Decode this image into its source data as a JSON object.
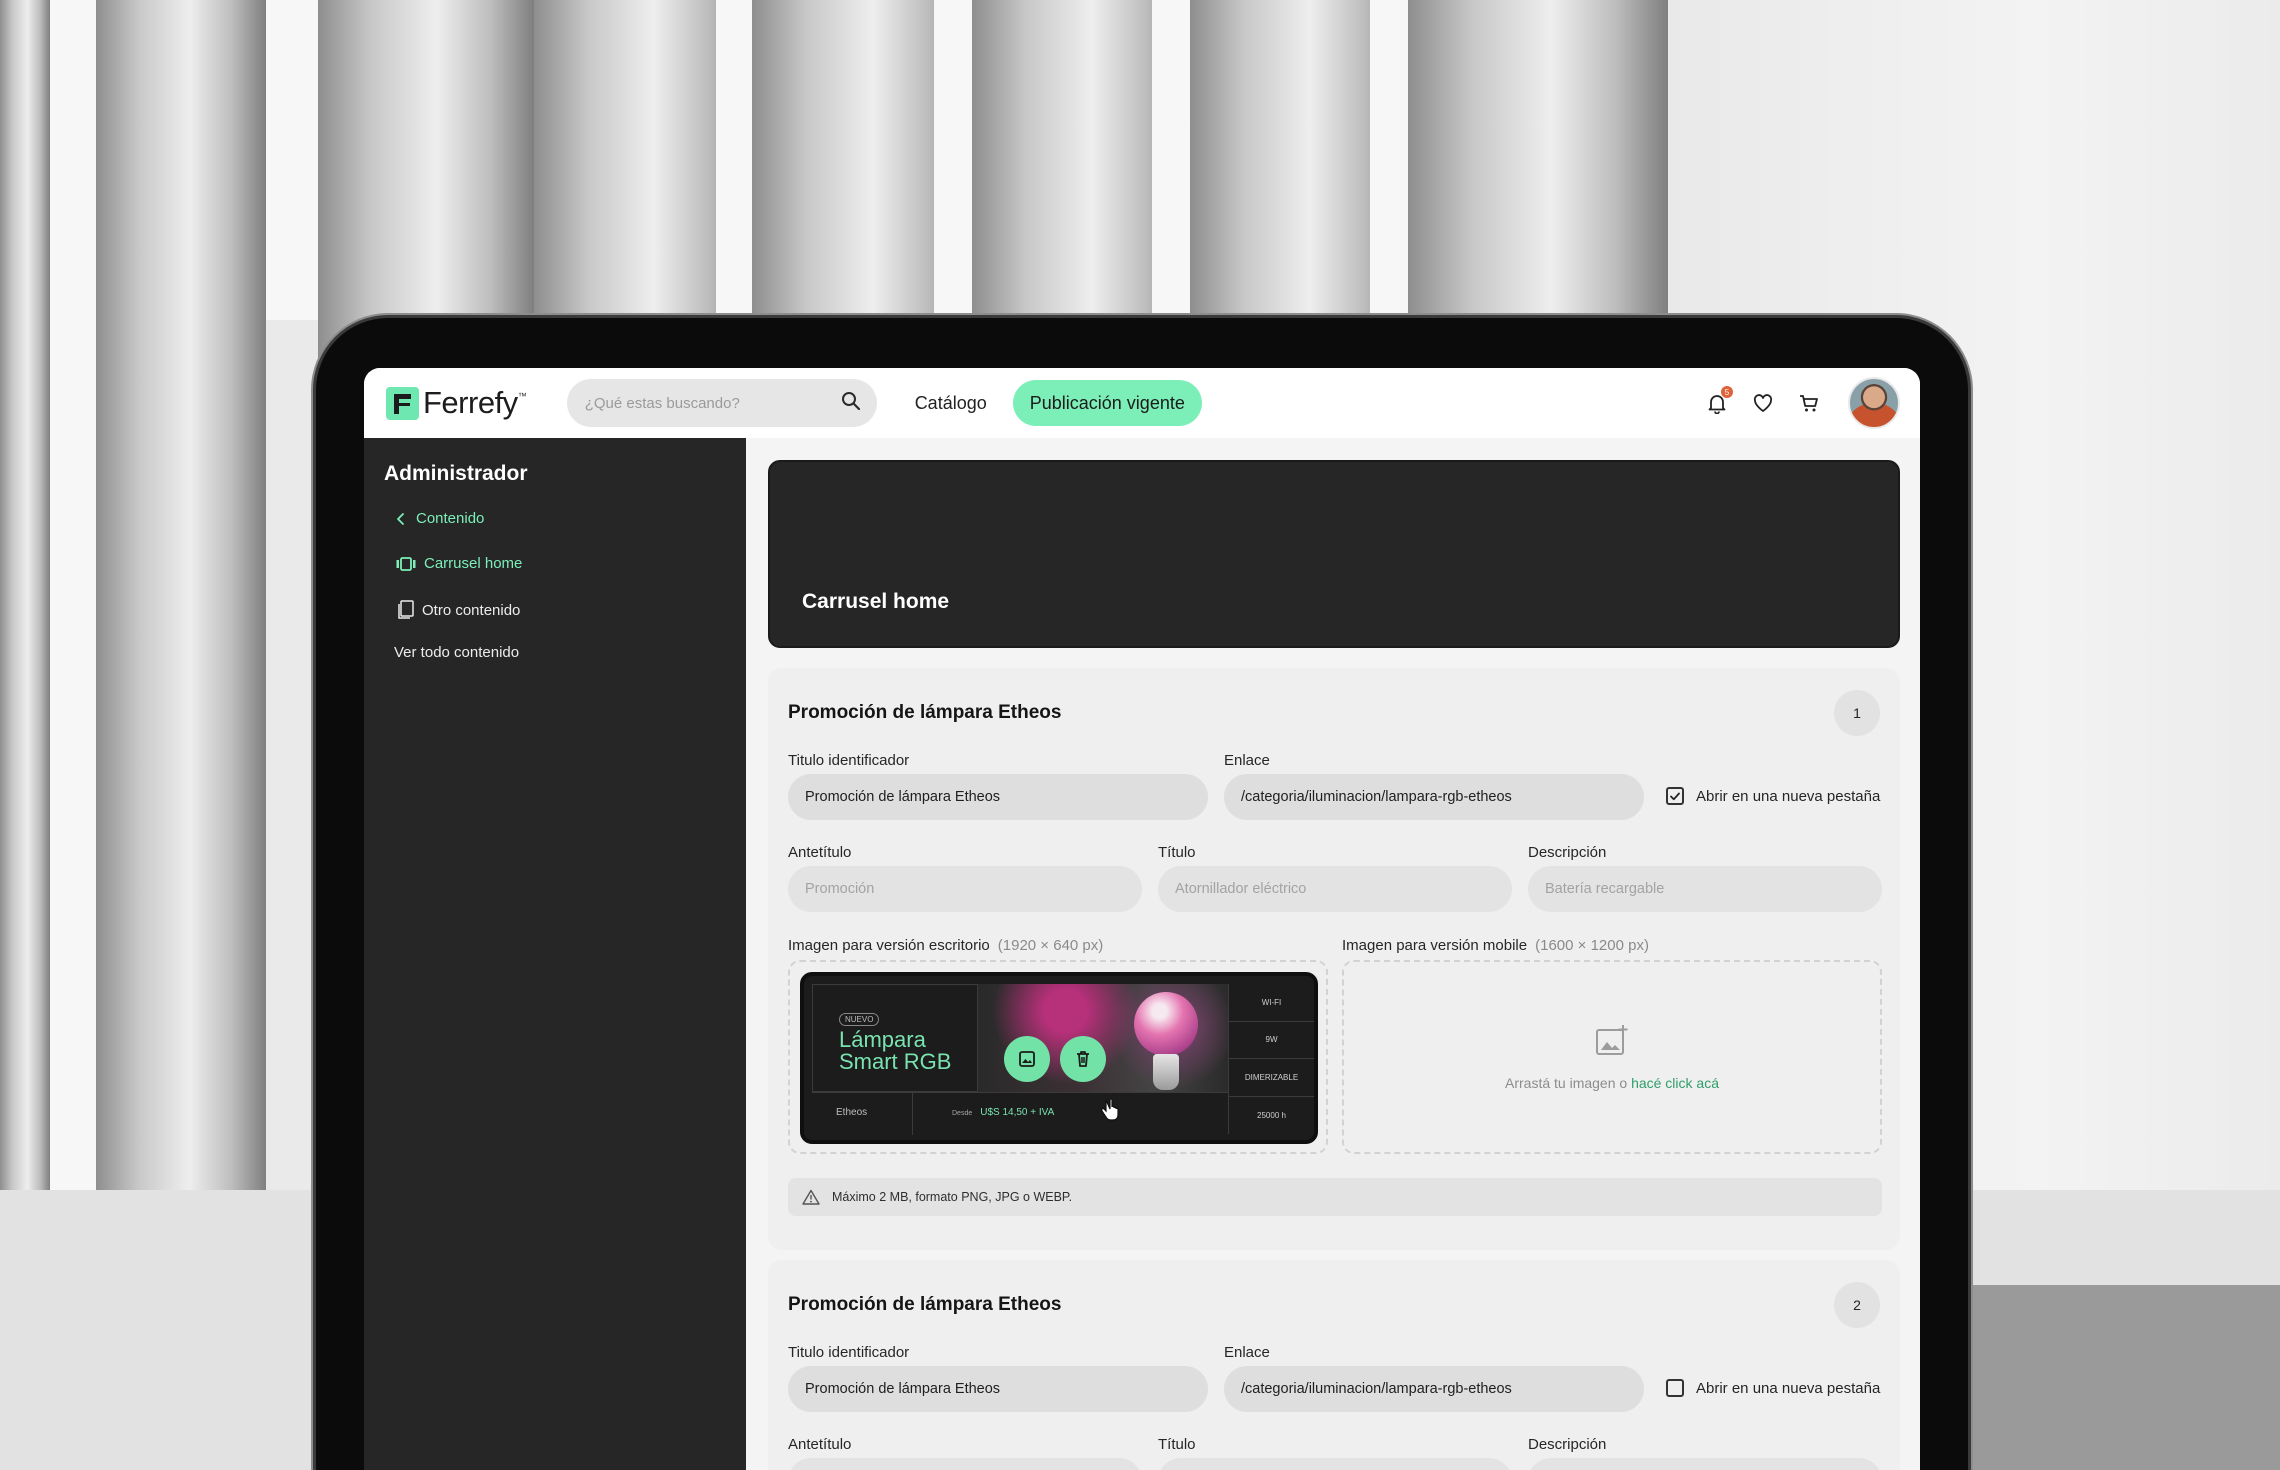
{
  "brand": {
    "name": "Ferrefy",
    "tm": "™",
    "accent": "#7cefb8"
  },
  "topnav": {
    "search_placeholder": "¿Qué estas buscando?",
    "catalog_label": "Catálogo",
    "active_pill": "Publicación vigente",
    "notification_count": "5"
  },
  "sidebar": {
    "title": "Administrador",
    "back_label": "Contenido",
    "items": [
      {
        "label": "Carrusel home",
        "active": true,
        "icon": "carousel-icon"
      },
      {
        "label": "Otro contenido",
        "active": false,
        "icon": "copy-icon"
      },
      {
        "label": "Ver todo contenido",
        "active": false,
        "icon": ""
      }
    ]
  },
  "hero": {
    "title": "Carrusel home"
  },
  "cards": [
    {
      "title": "Promoción de lámpara Etheos",
      "number": "1",
      "id_title_label": "Titulo identificador",
      "id_title_value": "Promoción de lámpara Etheos",
      "link_label": "Enlace",
      "link_value": "/categoria/iluminacion/lampara-rgb-etheos",
      "new_tab_label": "Abrir en una nueva pestaña",
      "new_tab_checked": true,
      "pretitle_label": "Antetítulo",
      "pretitle_placeholder": "Promoción",
      "title_label": "Título",
      "title_placeholder": "Atornillador eléctrico",
      "desc_label": "Descripción",
      "desc_placeholder": "Batería recargable",
      "desktop_image_label": "Imagen para versión escritorio",
      "desktop_image_size": "(1920 × 640 px)",
      "mobile_image_label": "Imagen para versión mobile",
      "mobile_image_size": "(1600 × 1200 px)",
      "drop_text": "Arrastá tu imagen o",
      "drop_link": "hacé click acá",
      "notice": "Máximo 2 MB, formato PNG, JPG o WEBP.",
      "banner": {
        "tag": "NUEVO",
        "title_line1": "Lámpara",
        "title_line2": "Smart RGB",
        "brand": "Etheos",
        "price_prefix": "Desde",
        "price": "U$S 14,50 + IVA",
        "specs": [
          "WI-FI",
          "9W",
          "DIMERIZABLE",
          "25000 h"
        ]
      }
    },
    {
      "title": "Promoción de lámpara Etheos",
      "number": "2",
      "id_title_label": "Titulo identificador",
      "id_title_value": "Promoción de lámpara Etheos",
      "link_label": "Enlace",
      "link_value": "/categoria/iluminacion/lampara-rgb-etheos",
      "new_tab_label": "Abrir en una nueva pestaña",
      "new_tab_checked": false,
      "pretitle_label": "Antetítulo",
      "title_label": "Título",
      "desc_label": "Descripción"
    }
  ]
}
